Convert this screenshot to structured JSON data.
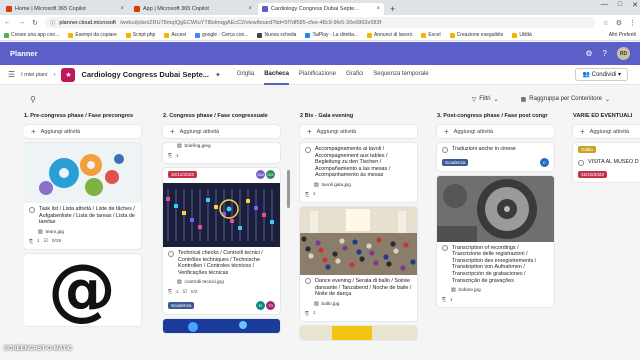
{
  "browser": {
    "tabs": [
      {
        "title": "Home | Microsoft 365 Copilot",
        "active": false,
        "color": "#d83b01"
      },
      {
        "title": "App | Microsoft 365 Copilot",
        "active": false,
        "color": "#d83b01"
      },
      {
        "title": "Cardiology Congress Dubai Septe...",
        "active": true,
        "color": "#5b5fc7"
      }
    ],
    "new_tab": "+",
    "url_host": "planner.cloud.microsoft",
    "url_path": "/webui/plan/ZRU78mqIQgECWtuYTl8sImqgAEcC2/view/board?tid=5f7df585-cfee-48c9-9fe5-30e6862e583f",
    "bookmarks": [
      {
        "label": "Creare una app con...",
        "color": "#4caf50"
      },
      {
        "label": "Esempi da copiare",
        "color": "#f4b400"
      },
      {
        "label": "Script php",
        "color": "#f4b400"
      },
      {
        "label": "Accesi",
        "color": "#f4b400"
      },
      {
        "label": "google - Cerca con...",
        "color": "#4285f4"
      },
      {
        "label": "Nuova scheda",
        "color": "#444444"
      },
      {
        "label": "TaiPlay - La diretta...",
        "color": "#1e88e5"
      },
      {
        "label": "Annunci di lavoro",
        "color": "#f4b400"
      },
      {
        "label": "Excel",
        "color": "#f4b400"
      },
      {
        "label": "Creazione eseguibile",
        "color": "#f4b400"
      },
      {
        "label": "Utilità",
        "color": "#f4b400"
      }
    ],
    "other_bookmarks": "Altri Preferiti"
  },
  "app": {
    "name": "Planner",
    "user_initials": "RD",
    "my_plans": "I miei piani",
    "plan_title": "Cardiology Congress Dubai Septe...",
    "views": [
      {
        "label": "Griglia",
        "selected": false
      },
      {
        "label": "Bacheca",
        "selected": true
      },
      {
        "label": "Pianificazione",
        "selected": false
      },
      {
        "label": "Grafici",
        "selected": false
      },
      {
        "label": "Sequenza temporale",
        "selected": false
      }
    ],
    "share": "Condividi",
    "filters": "Filtri",
    "group_by": "Raggruppa per Contenitore"
  },
  "add_task": "Aggiungi attività",
  "columns": [
    {
      "title": "1. Pre-congress phase / Fase precongres",
      "cards": [
        {
          "image": "gears",
          "title": "Task list / Lista attività / Liste de tâches / Aufgabenliste / Lista de tareas / Lista de tarefas",
          "attachment": "team.jpg",
          "meta": [
            "1",
            "0/39"
          ]
        },
        {
          "image": "at-sign"
        }
      ]
    },
    {
      "title": "2. Congress phase / Fase congressuale",
      "cards": [
        {
          "attachment": "briefing.jpeg",
          "meta": [
            "1"
          ],
          "partial": true
        },
        {
          "date": "10/11/2023",
          "people": [
            {
              "i": "GM",
              "c": "#7a5cc0"
            },
            {
              "i": "GG",
              "c": "#2e8b57"
            }
          ],
          "image": "mixer",
          "title": "Technical checks / Controlli tecnici / Contrôles techniques / Technische Kontrollen / Controles técnicos / Verificações técnicas",
          "attachment": "controlli tecnici.jpg",
          "meta": [
            "1",
            "0/2"
          ],
          "label": "Scadenza",
          "label_color": "#3d5a96",
          "people2": [
            {
              "i": "EI",
              "c": "#0e8a8a"
            },
            {
              "i": "TS",
              "c": "#a4266f"
            }
          ]
        },
        {
          "image": "blue-lights",
          "partial": true
        }
      ]
    },
    {
      "title": "2 Bis - Gala evening",
      "cards": [
        {
          "title": "Accompagnamento ai tavoli / Accompagnement aux tables / Begleitung zu den Tischen / Acompañamiento a las mesas / Acompanhamento às mesas",
          "attachment": "tavoli gala.jpg",
          "meta": [
            "1"
          ]
        },
        {
          "image": "ballroom",
          "title": "Dance evening / Serata di ballo / Soirée dansante / Tanzabend / Noche de baile / Noite de dança",
          "attachment": "ballo.jpg",
          "meta": [
            "1"
          ]
        },
        {
          "image": "yellow",
          "partial": true
        }
      ]
    },
    {
      "title": "3. Post-congress phase / Fase post congr",
      "cards": [
        {
          "title": "Traduzioni anche in cinese",
          "label": "Scadenza",
          "label_color": "#3d5a96",
          "people": [
            {
              "i": "E",
              "c": "#1e6fc4"
            }
          ]
        },
        {
          "image": "reel",
          "title": "Transcription of recordings / Trascrizione delle registrazioni / Transcription des enregistrements / Transkription von Aufnahmen / Transcripción de grabaciones / Transcrição de gravações",
          "attachment": "bobine.jpg",
          "meta": [
            "1"
          ]
        }
      ]
    },
    {
      "title": "VARIE ED EVENTUALI",
      "cards": [
        {
          "label": "Gialla",
          "label_color": "#c9a227",
          "title": "VISITA AL MUSEO D",
          "date": "15/10/2023"
        }
      ]
    }
  ],
  "watermark": "SCREENCAST-O-MATIC"
}
